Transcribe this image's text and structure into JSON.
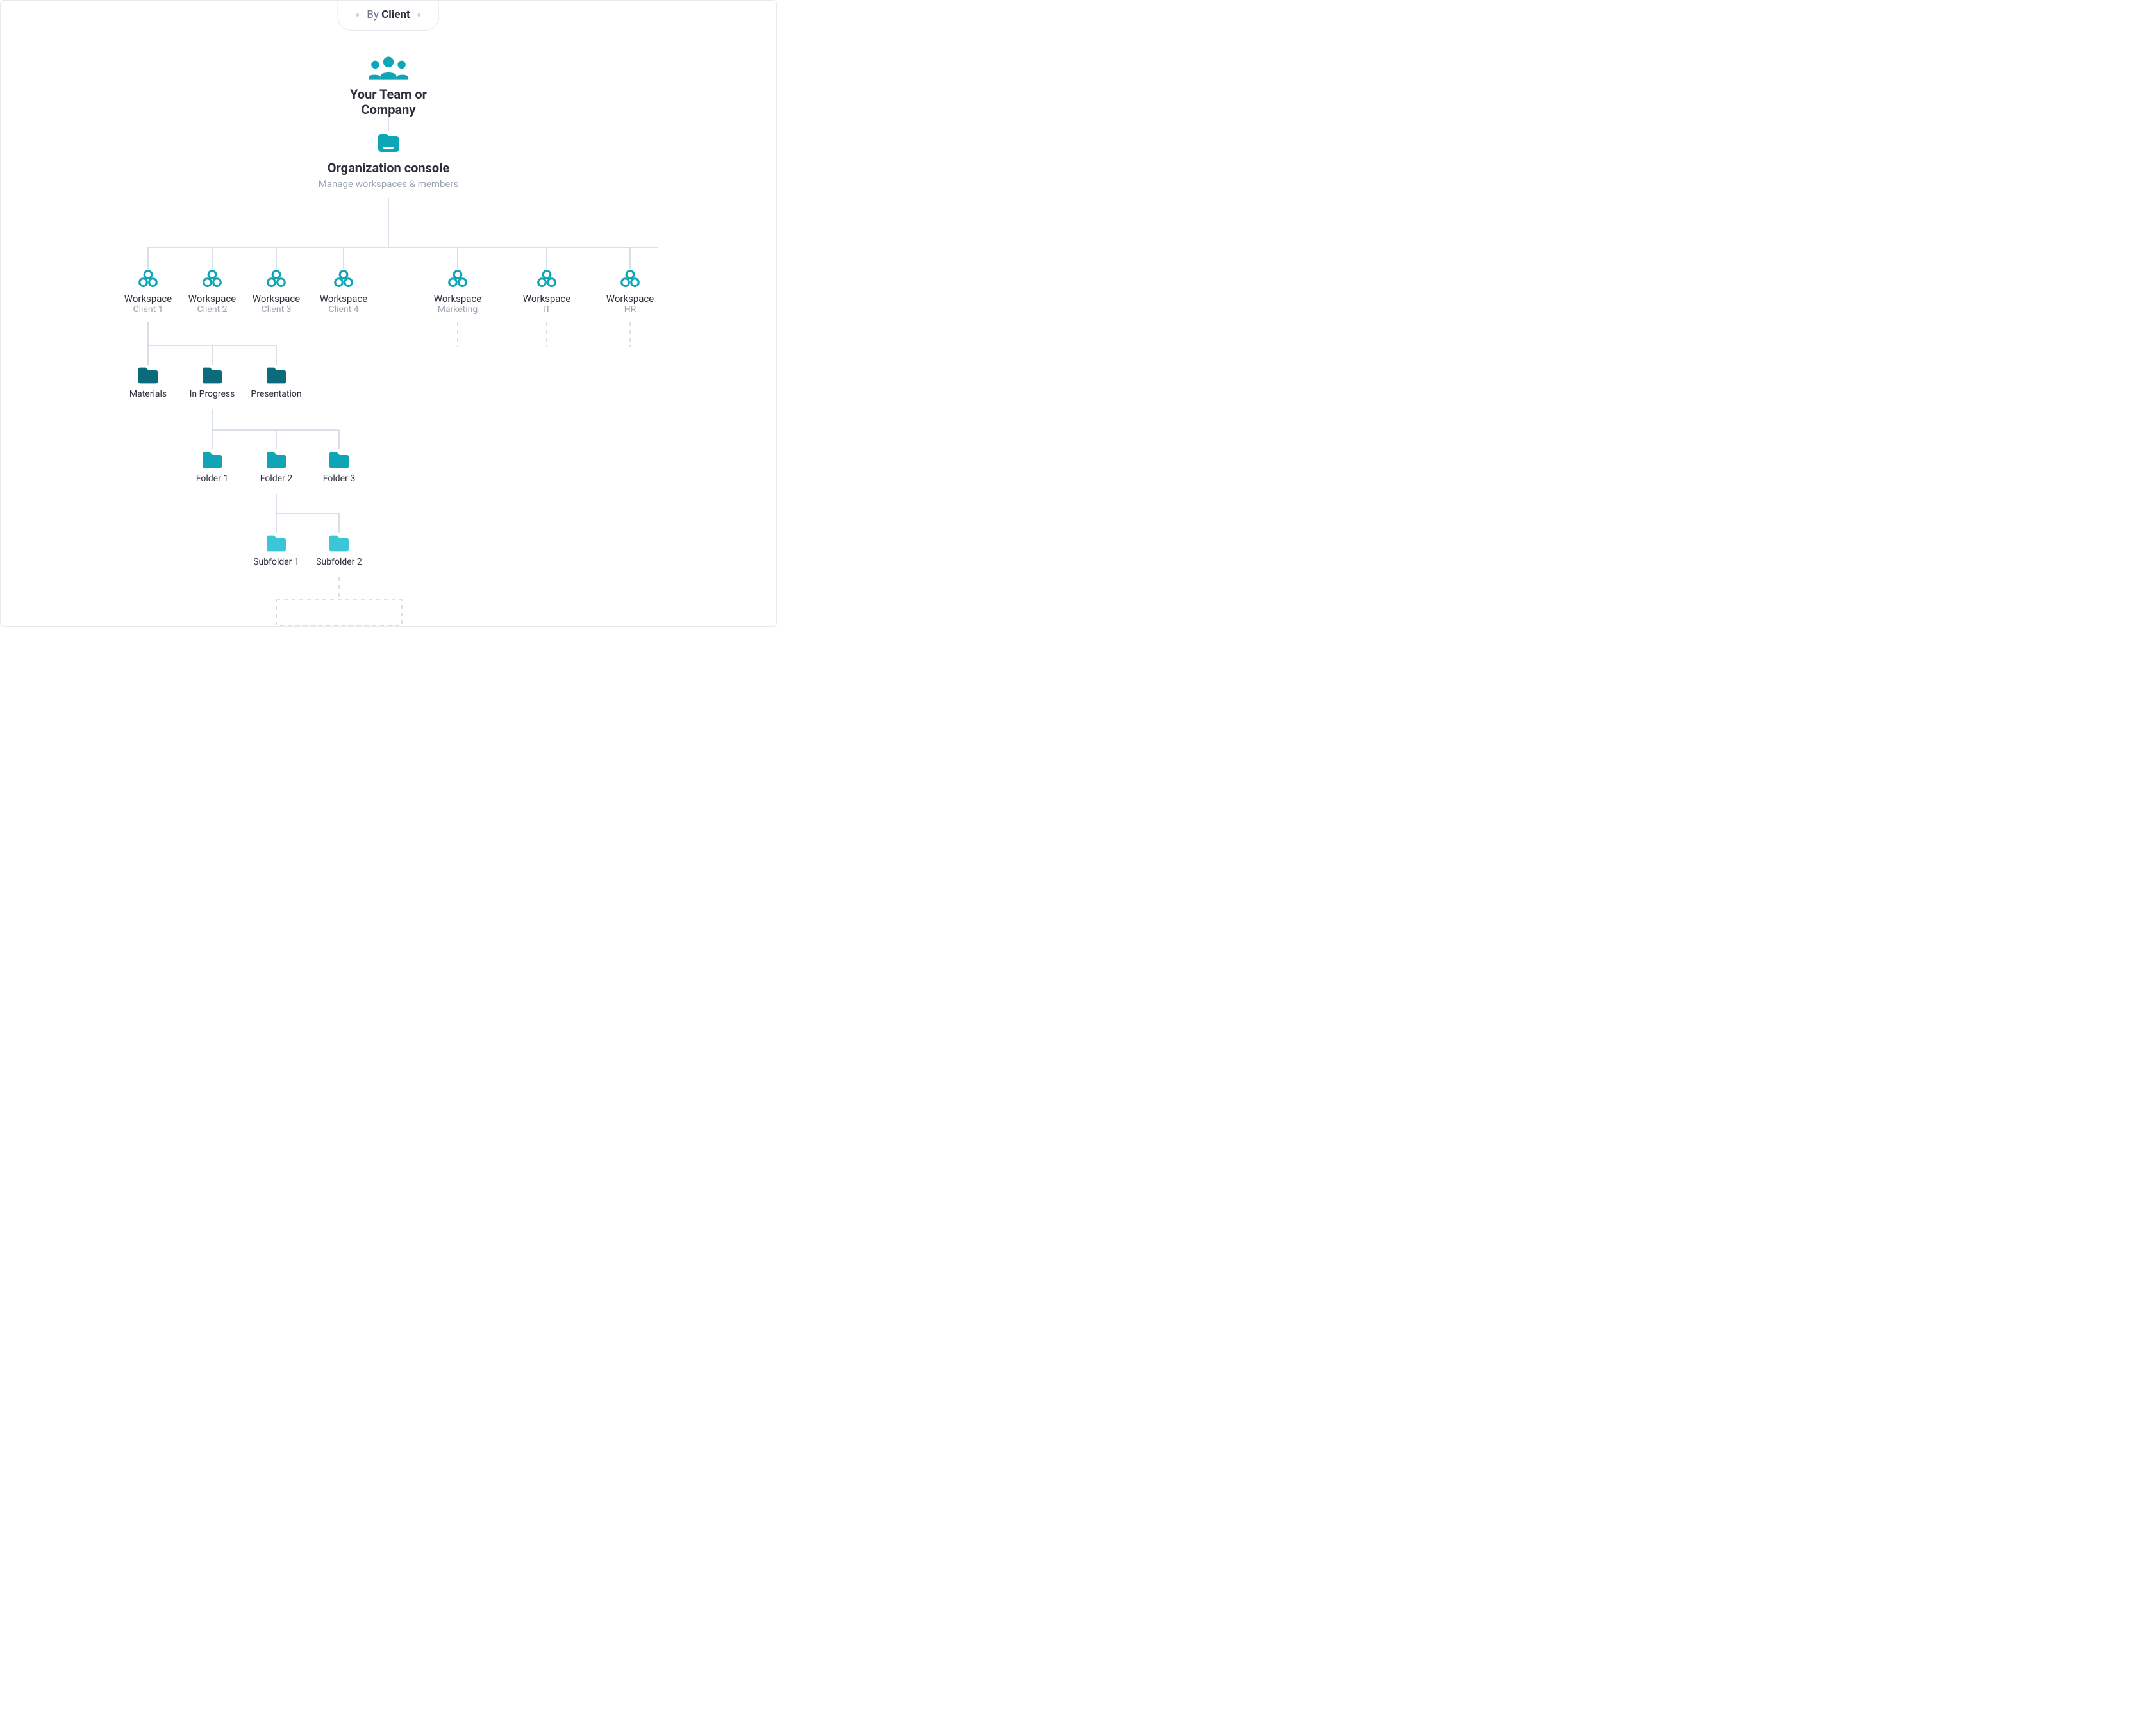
{
  "tab": {
    "prefix": "By",
    "emph": "Client"
  },
  "root": {
    "title": "Your Team or Company"
  },
  "console": {
    "title": "Organization console",
    "sub": "Manage workspaces & members"
  },
  "workspaces": [
    {
      "title": "Workspace",
      "sub": "Client 1"
    },
    {
      "title": "Workspace",
      "sub": "Client 2"
    },
    {
      "title": "Workspace",
      "sub": "Client 3"
    },
    {
      "title": "Workspace",
      "sub": "Client 4"
    },
    {
      "title": "Workspace",
      "sub": "Marketing"
    },
    {
      "title": "Workspace",
      "sub": "IT"
    },
    {
      "title": "Workspace",
      "sub": "HR"
    }
  ],
  "foldersL1": [
    {
      "title": "Materials"
    },
    {
      "title": "In Progress"
    },
    {
      "title": "Presentation"
    }
  ],
  "foldersL2": [
    {
      "title": "Folder 1"
    },
    {
      "title": "Folder 2"
    },
    {
      "title": "Folder 3"
    }
  ],
  "foldersL3": [
    {
      "title": "Subfolder 1"
    },
    {
      "title": "Subfolder 2"
    }
  ],
  "colors": {
    "teal": "#0ea5b7",
    "darkteal": "#0b6b7a",
    "lightteal": "#3ac6d8",
    "line": "#cfd7e2",
    "dash": "#cfd7e2",
    "text": "#2b2f3c",
    "muted": "#9aa3b2"
  }
}
